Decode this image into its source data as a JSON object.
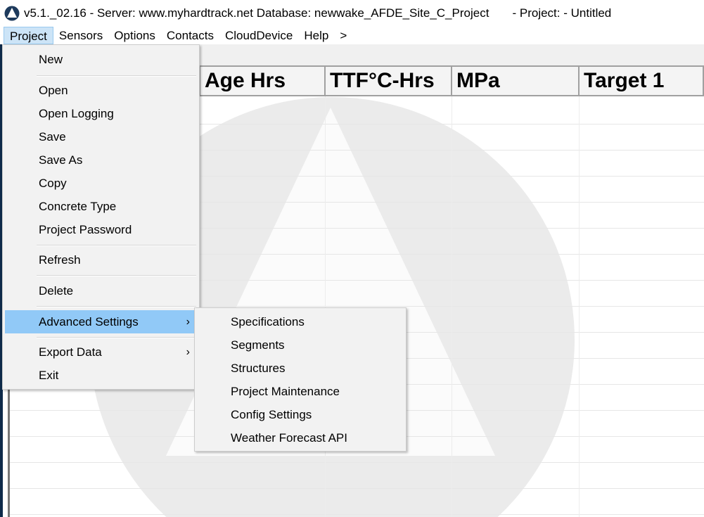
{
  "title": "v5.1._02.16 - Server: www.myhardtrack.net Database: newwake_AFDE_Site_C_Project       - Project: - Untitled",
  "menubar": [
    "Project",
    "Sensors",
    "Options",
    "Contacts",
    "CloudDevice",
    "Help",
    ">"
  ],
  "grid": {
    "columns": [
      "Age Hrs",
      "TTF°C-Hrs",
      "MPa",
      "Target 1"
    ]
  },
  "project_menu": {
    "items": [
      "New",
      "Open",
      "Open Logging",
      "Save",
      "Save As",
      "Copy",
      "Concrete Type",
      "Project Password",
      "Refresh",
      "Delete",
      "Advanced Settings",
      "Export Data",
      "Exit"
    ],
    "submenu_arrow": "›"
  },
  "advanced_submenu": {
    "items": [
      "Specifications",
      "Segments",
      "Structures",
      "Project Maintenance",
      "Config Settings",
      "Weather Forecast API"
    ]
  },
  "colors": {
    "highlight": "#91c9f7",
    "menubar_active": "#cce4f7",
    "frame": "#0e2a4a"
  }
}
